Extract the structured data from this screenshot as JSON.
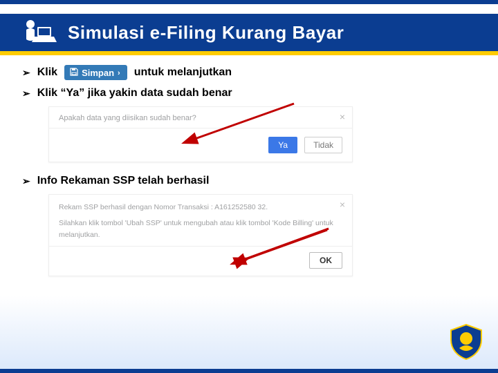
{
  "header": {
    "title": "Simulasi e-Filing Kurang Bayar"
  },
  "bullets": {
    "b1_pre": "Klik",
    "b1_post": "untuk melanjutkan",
    "b2": "Klik “Ya” jika yakin data sudah benar",
    "b3": "Info Rekaman SSP telah berhasil"
  },
  "simpan_button": {
    "label": "Simpan",
    "chevron": "›"
  },
  "modal_confirm": {
    "question": "Apakah data yang diisikan sudah benar?",
    "yes": "Ya",
    "no": "Tidak",
    "close": "×"
  },
  "modal_result": {
    "line1": "Rekam SSP berhasil dengan Nomor Transaksi : A161252580 32.",
    "line2": "Silahkan klik tombol 'Ubah SSP' untuk mengubah atau klik tombol 'Kode Billing' untuk",
    "line3": "melanjutkan.",
    "ok": "OK",
    "close": "×"
  },
  "glyphs": {
    "bullet": "➢"
  }
}
